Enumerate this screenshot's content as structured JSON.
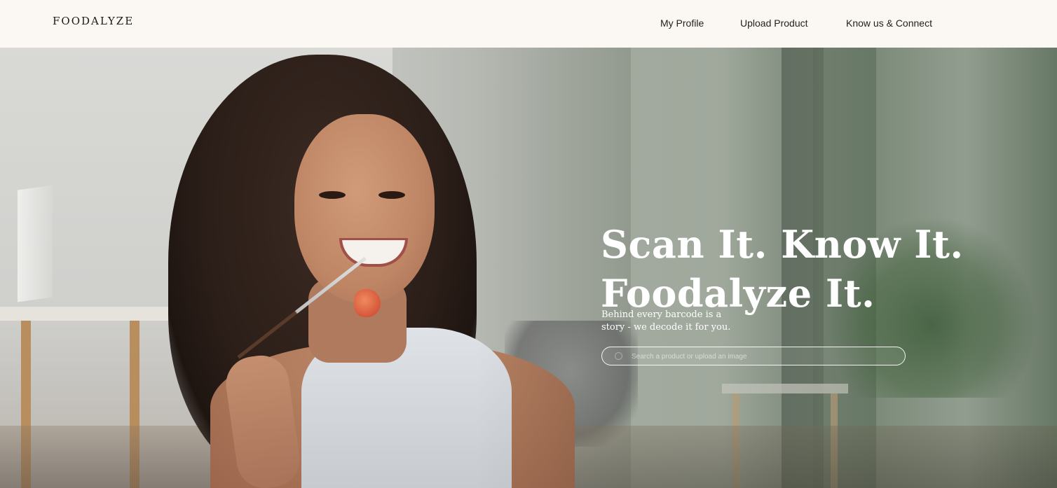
{
  "header": {
    "logo": "FOODALYZE",
    "nav": {
      "my_profile": "My Profile",
      "upload_product": "Upload Product",
      "know_us_connect": "Know us & Connect"
    }
  },
  "hero": {
    "headline_line1": "Scan It. Know It.",
    "headline_line2": "Foodalyze It.",
    "tagline_line1": "Behind every barcode is a",
    "tagline_line2": "story - we decode it for you.",
    "search": {
      "placeholder": "Search a product or upload an image",
      "value": ""
    }
  },
  "colors": {
    "header_bg": "#fbf8f3",
    "hero_text": "#ffffff",
    "nav_text": "#1f1f1f"
  },
  "icons": {
    "search": "search-icon"
  }
}
